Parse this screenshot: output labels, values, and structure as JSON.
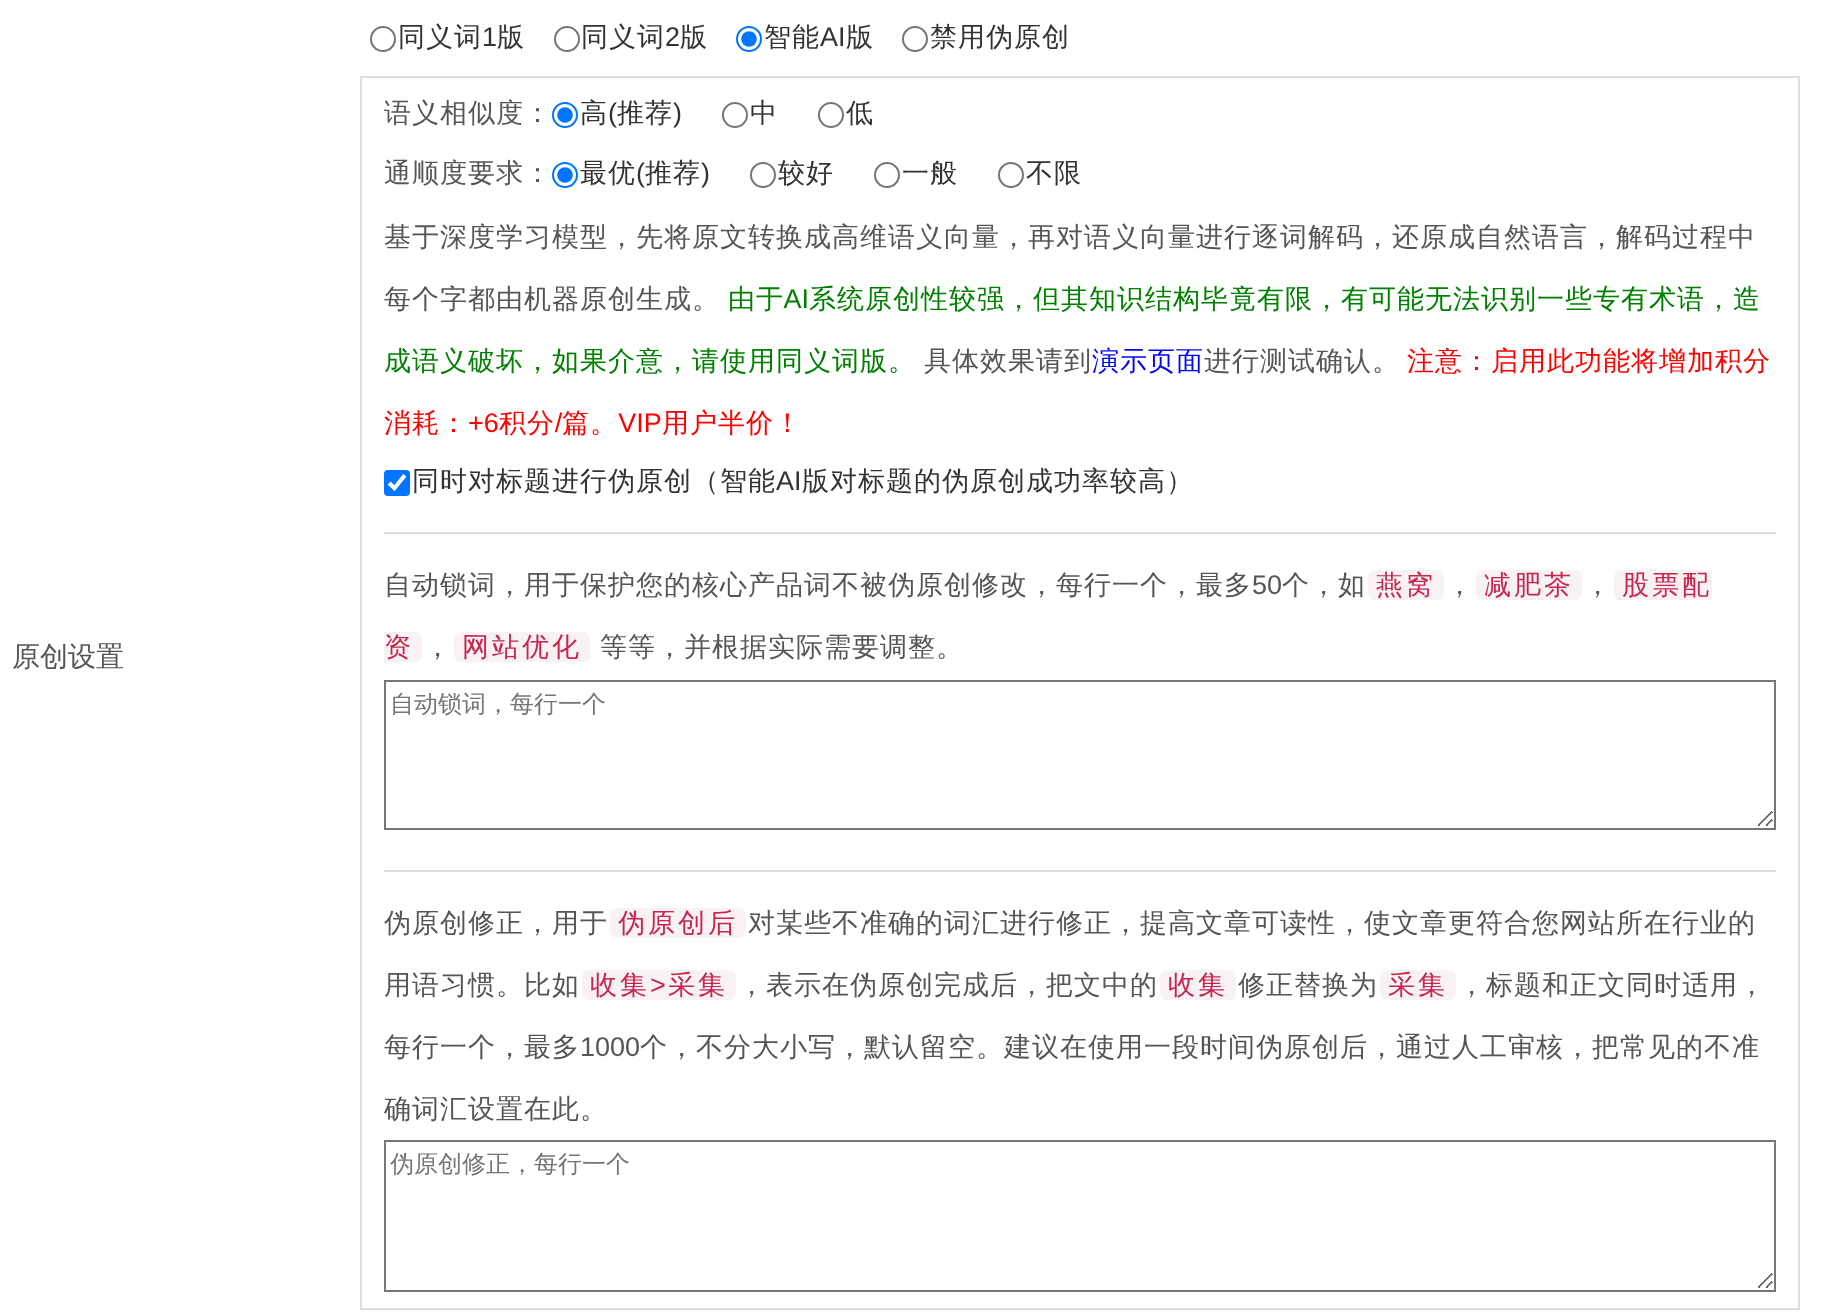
{
  "mode_options": [
    {
      "label": "同义词1版",
      "selected": false
    },
    {
      "label": "同义词2版",
      "selected": false
    },
    {
      "label": "智能AI版",
      "selected": true
    },
    {
      "label": "禁用伪原创",
      "selected": false
    }
  ],
  "side_label": "原创设置",
  "similarity": {
    "label": "语义相似度：",
    "options": [
      {
        "label": "高(推荐)",
        "selected": true
      },
      {
        "label": "中",
        "selected": false
      },
      {
        "label": "低",
        "selected": false
      }
    ]
  },
  "fluency": {
    "label": "通顺度要求：",
    "options": [
      {
        "label": "最优(推荐)",
        "selected": true
      },
      {
        "label": "较好",
        "selected": false
      },
      {
        "label": "一般",
        "selected": false
      },
      {
        "label": "不限",
        "selected": false
      }
    ]
  },
  "description": [
    {
      "kind": "plain",
      "text": "基于深度学习模型，先将原文转换成高维语义向量，再对语义向量进行逐词解码，还原成自然语言，解码过程中每个字都由机器原创生成。 "
    },
    {
      "kind": "success",
      "text": "由于AI系统原创性较强，但其知识结构毕竟有限，有可能无法识别一些专有术语，造成语义破坏，如果介意，请使用同义词版。"
    },
    {
      "kind": "plain",
      "text": " 具体效果请到"
    },
    {
      "kind": "link",
      "text": "演示页面"
    },
    {
      "kind": "plain",
      "text": "进行测试确认。 "
    },
    {
      "kind": "warning",
      "text": "注意：启用此功能将增加积分消耗：+6积分/篇。VIP用户半价！"
    }
  ],
  "title_option": {
    "label": "同时对标题进行伪原创（智能AI版对标题的伪原创成功率较高）",
    "checked": true
  },
  "lock_words": {
    "description": [
      {
        "kind": "text",
        "text": "自动锁词，用于保护您的核心产品词不被伪原创修改，每行一个，最多50个，如"
      },
      {
        "kind": "tag",
        "text": "燕窝"
      },
      {
        "kind": "text",
        "text": "，"
      },
      {
        "kind": "tag",
        "text": "减肥茶"
      },
      {
        "kind": "text",
        "text": "，"
      },
      {
        "kind": "tag",
        "text": "股票配资"
      },
      {
        "kind": "text",
        "text": "，"
      },
      {
        "kind": "tag",
        "text": "网站优化"
      },
      {
        "kind": "text",
        "text": " 等等，并根据实际需要调整。"
      }
    ],
    "placeholder": "自动锁词，每行一个"
  },
  "correction": {
    "description": [
      {
        "kind": "text",
        "text": "伪原创修正，用于"
      },
      {
        "kind": "tag",
        "text": "伪原创后"
      },
      {
        "kind": "text",
        "text": "对某些不准确的词汇进行修正，提高文章可读性，使文章更符合您网站所在行业的用语习惯。比如"
      },
      {
        "kind": "tag",
        "text": "收集>采集"
      },
      {
        "kind": "text",
        "text": "，表示在伪原创完成后，把文中的"
      },
      {
        "kind": "tag",
        "text": "收集"
      },
      {
        "kind": "text",
        "text": "修正替换为"
      },
      {
        "kind": "tag",
        "text": "采集"
      },
      {
        "kind": "text",
        "text": "，标题和正文同时适用，每行一个，最多1000个，不分大小写，默认留空。建议在使用一段时间伪原创后，通过人工审核，把常见的不准确词汇设置在此。"
      }
    ],
    "placeholder": "伪原创修正，每行一个"
  }
}
